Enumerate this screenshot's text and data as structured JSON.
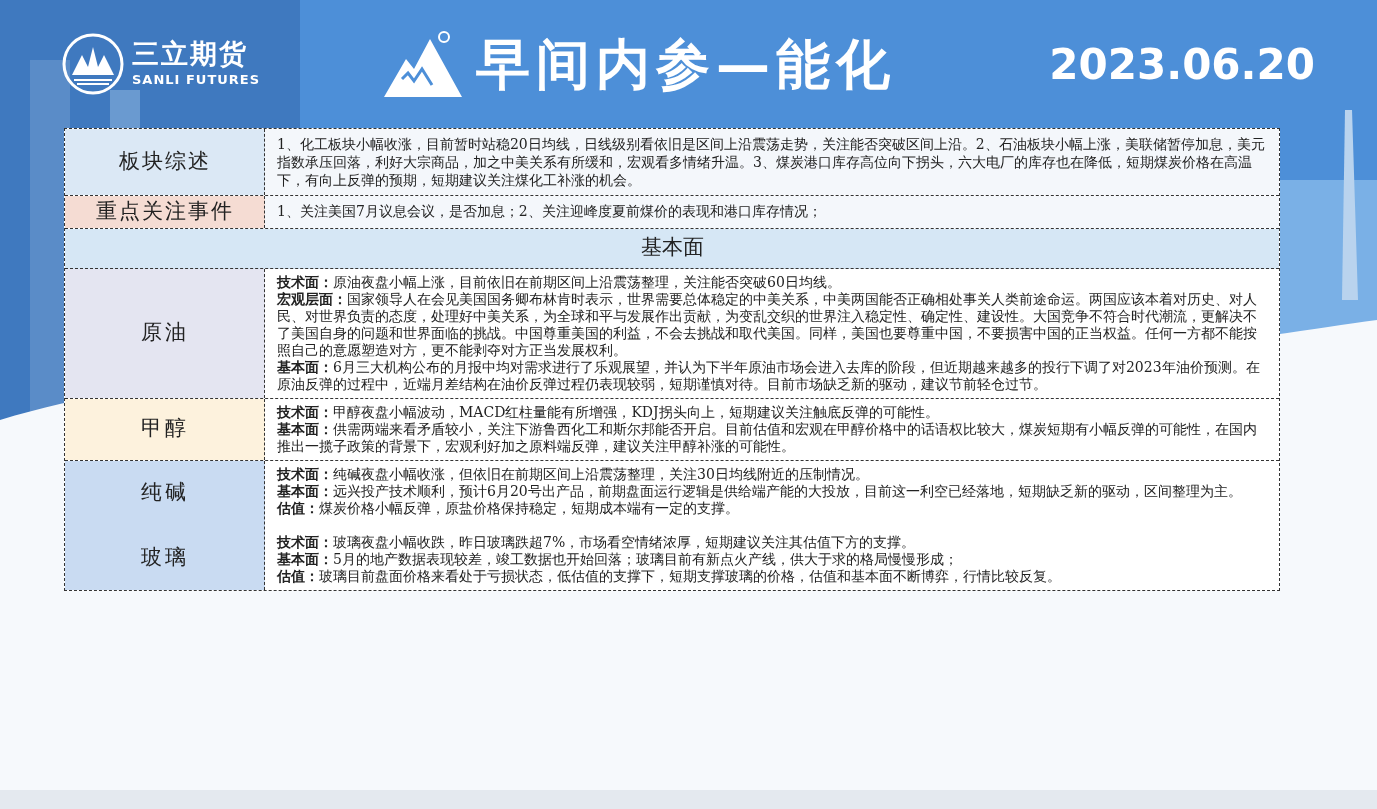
{
  "header": {
    "logo_name": "三立期货",
    "logo_name_en": "SANLI FUTURES",
    "title": "早间内参—能化",
    "date": "2023.06.20"
  },
  "summary_rows": [
    {
      "label": "板块综述",
      "color": "#dbe8f5",
      "text": "1、化工板块小幅收涨，目前暂时站稳20日均线，日线级别看依旧是区间上沿震荡走势，关注能否突破区间上沿。2、石油板块小幅上涨，美联储暂停加息，美元指数承压回落，利好大宗商品，加之中美关系有所缓和，宏观看多情绪升温。3、煤炭港口库存高位向下拐头，六大电厂的库存也在降低，短期煤炭价格在高温下，有向上反弹的预期，短期建议关注煤化工补涨的机会。"
    },
    {
      "label": "重点关注事件",
      "color": "#f5dcd3",
      "text": "1、关注美国7月议息会议，是否加息；2、关注迎峰度夏前煤价的表现和港口库存情况；"
    }
  ],
  "section_title": "基本面",
  "sections": [
    {
      "color": "#e4e5f1",
      "blocks": [
        {
          "label": "原油",
          "paragraphs": [
            "**技术面：**原油夜盘小幅上涨，目前依旧在前期区间上沿震荡整理，关注能否突破60日均线。",
            "**宏观层面：**国家领导人在会见美国国务卿布林肯时表示，世界需要总体稳定的中美关系，中美两国能否正确相处事关人类前途命运。两国应该本着对历史、对人民、对世界负责的态度，处理好中美关系，为全球和平与发展作出贡献，为变乱交织的世界注入稳定性、确定性、建设性。大国竞争不符合时代潮流，更解决不了美国自身的问题和世界面临的挑战。中国尊重美国的利益，不会去挑战和取代美国。同样，美国也要尊重中国，不要损害中国的正当权益。任何一方都不能按照自己的意愿塑造对方，更不能剥夺对方正当发展权利。",
            "**基本面：**6月三大机构公布的月报中均对需求进行了乐观展望，并认为下半年原油市场会进入去库的阶段，但近期越来越多的投行下调了对2023年油价预测。在原油反弹的过程中，近端月差结构在油价反弹过程仍表现较弱，短期谨慎对待。目前市场缺乏新的驱动，建议节前轻仓过节。"
          ]
        }
      ]
    },
    {
      "color": "#fdf2dd",
      "blocks": [
        {
          "label": "甲醇",
          "paragraphs": [
            "**技术面：**甲醇夜盘小幅波动，MACD红柱量能有所增强，KDJ拐头向上，短期建议关注触底反弹的可能性。",
            "**基本面：**供需两端来看矛盾较小，关注下游鲁西化工和斯尔邦能否开启。目前估值和宏观在甲醇价格中的话语权比较大，煤炭短期有小幅反弹的可能性，在国内推出一揽子政策的背景下，宏观利好加之原料端反弹，建议关注甲醇补涨的可能性。"
          ]
        }
      ]
    },
    {
      "color": "#c9dbf2",
      "blocks": [
        {
          "label": "纯碱",
          "paragraphs": [
            "**技术面：**纯碱夜盘小幅收涨，但依旧在前期区间上沿震荡整理，关注30日均线附近的压制情况。",
            "**基本面：**远兴投产技术顺利，预计6月20号出产品，前期盘面运行逻辑是供给端产能的大投放，目前这一利空已经落地，短期缺乏新的驱动，区间整理为主。",
            "**估值：**煤炭价格小幅反弹，原盐价格保持稳定，短期成本端有一定的支撑。"
          ]
        },
        {
          "label": "玻璃",
          "paragraphs": [
            "**技术面：**玻璃夜盘小幅收跌，昨日玻璃跌超7%，市场看空情绪浓厚，短期建议关注其估值下方的支撑。",
            "**基本面：**5月的地产数据表现较差，竣工数据也开始回落；玻璃目前有新点火产线，供大于求的格局慢慢形成；",
            "**估值：**玻璃目前盘面价格来看处于亏损状态，低估值的支撑下，短期支撑玻璃的价格，估值和基本面不断博弈，行情比较反复。"
          ]
        }
      ]
    }
  ]
}
